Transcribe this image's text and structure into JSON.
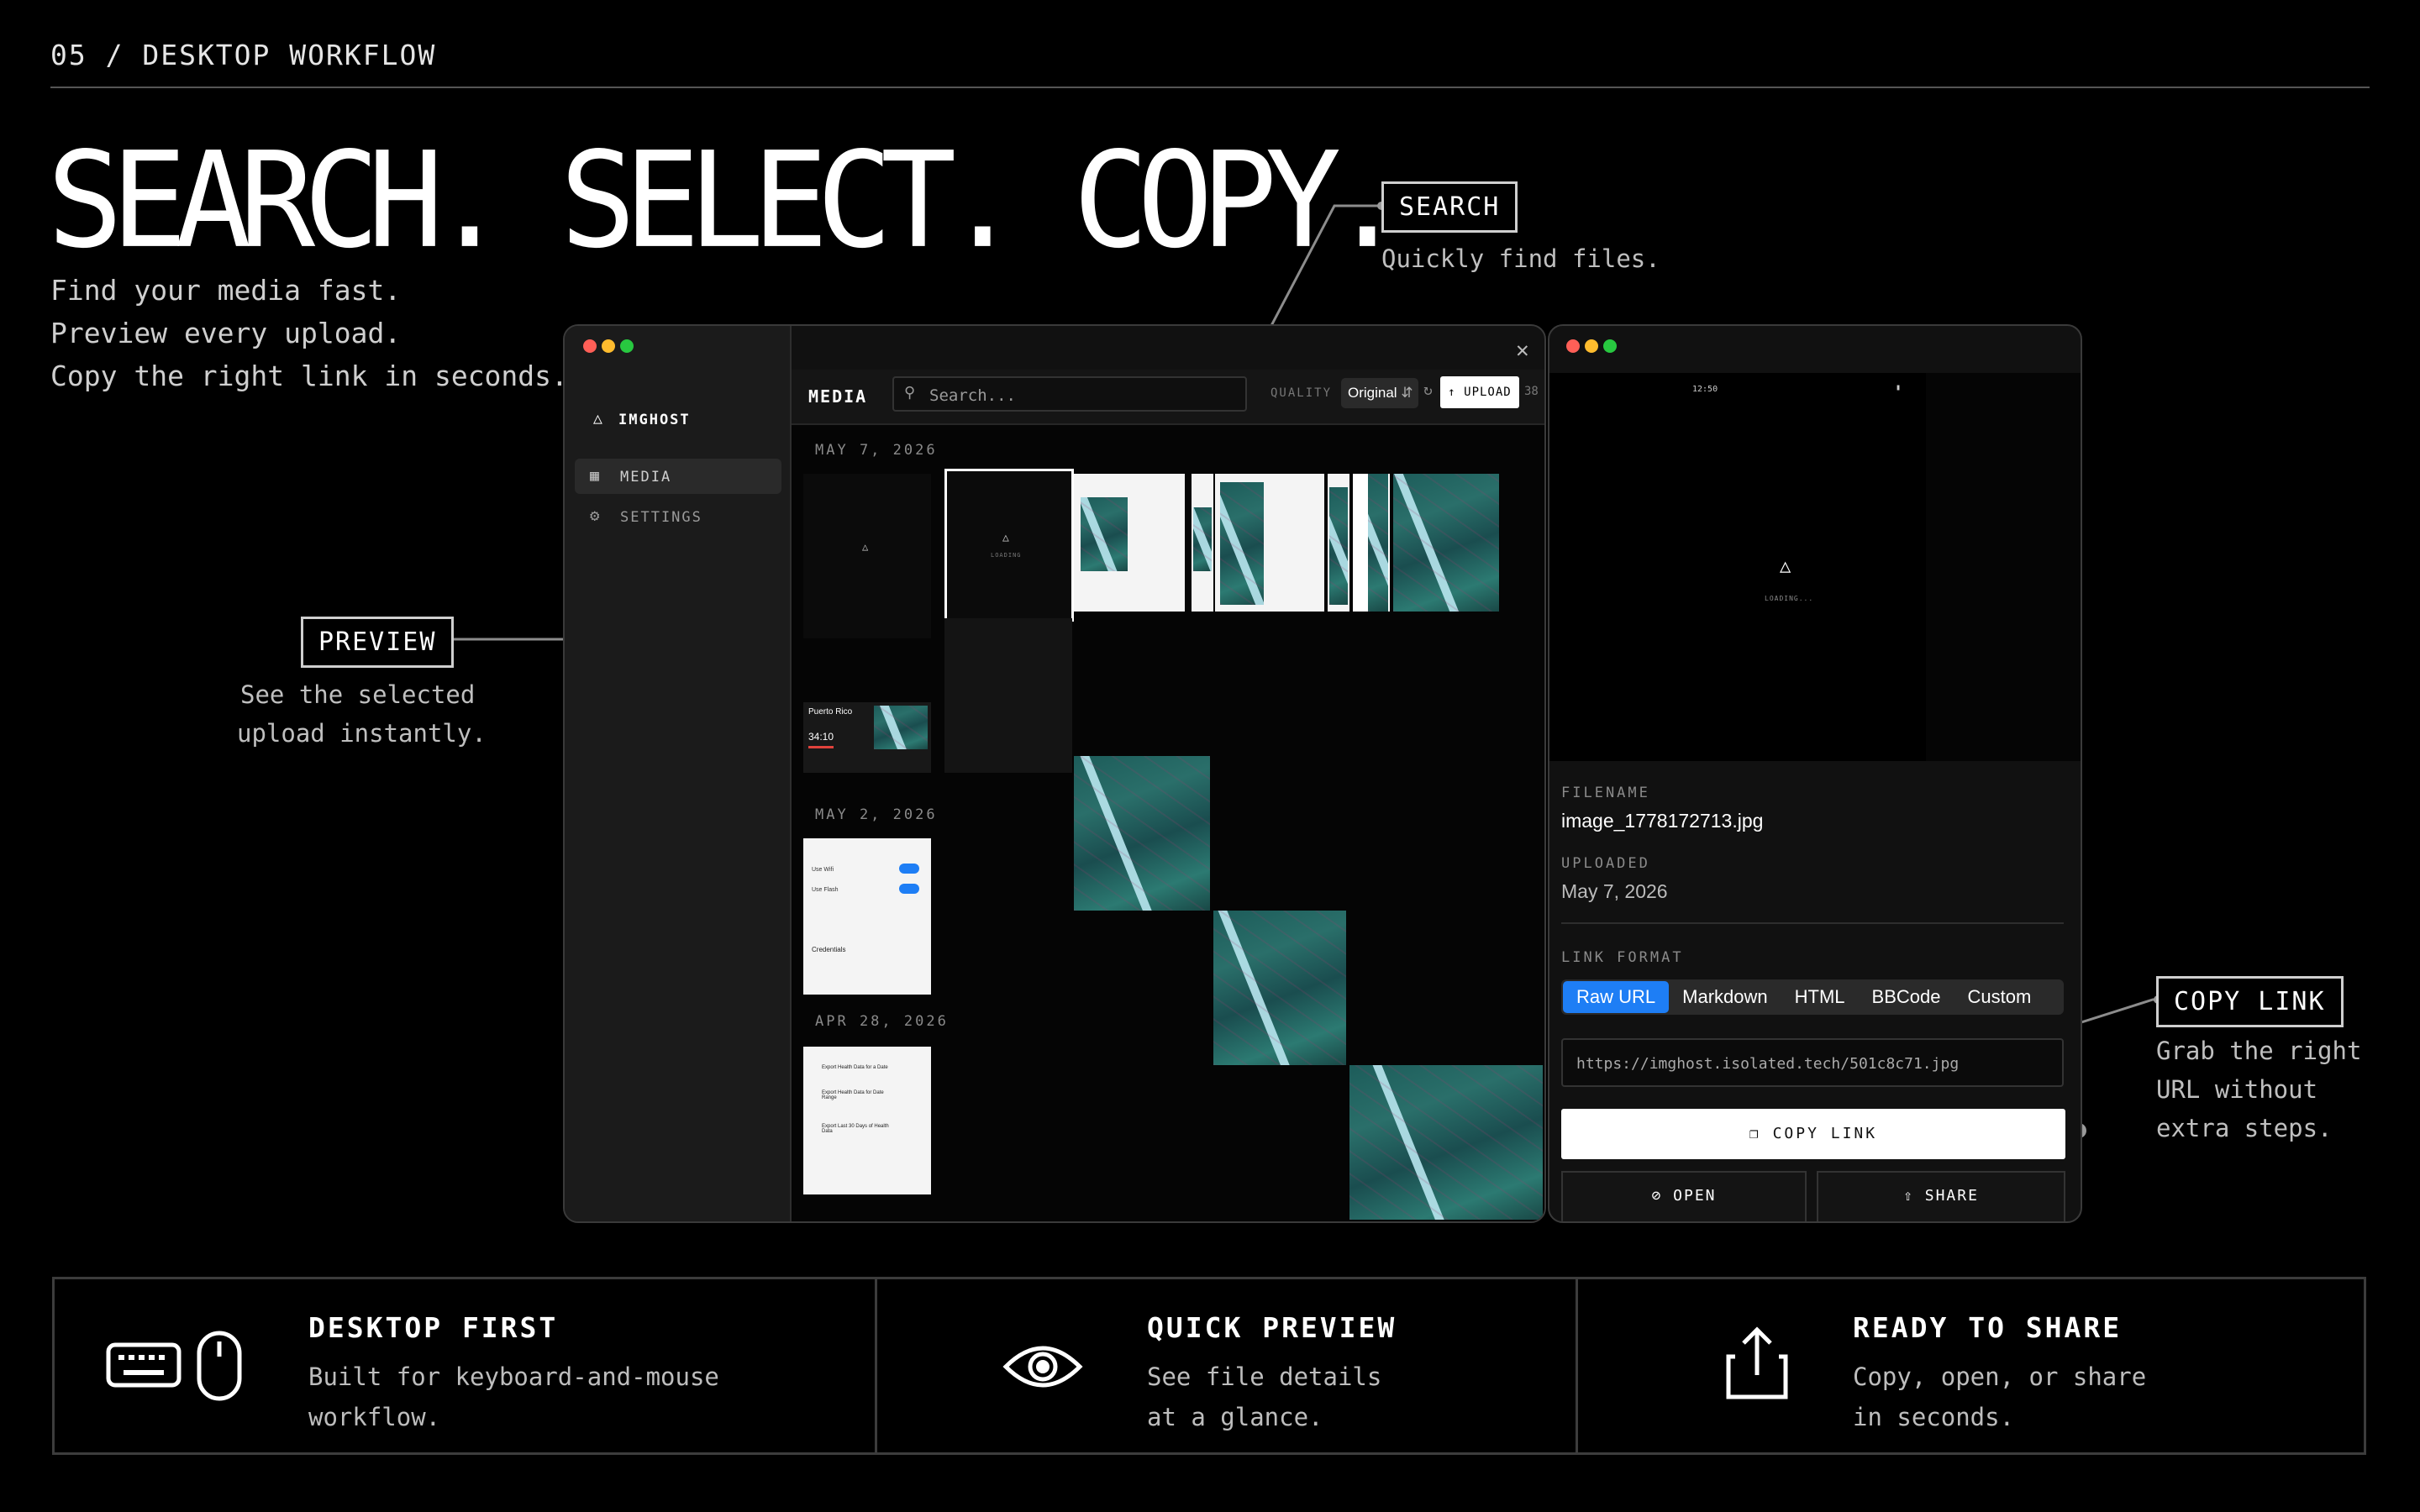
{
  "page": {
    "section_label": "05 / DESKTOP WORKFLOW",
    "headline": "SEARCH. SELECT. COPY.",
    "subtitle_lines": [
      "Find your media fast.",
      "Preview every upload.",
      "Copy the right link in seconds."
    ]
  },
  "callouts": {
    "search": {
      "title": "SEARCH",
      "text": "Quickly find files."
    },
    "preview": {
      "title": "PREVIEW",
      "line1": "See the selected",
      "line2": "upload instantly."
    },
    "copy_link": {
      "title": "COPY LINK",
      "line1": "Grab the right",
      "line2": "URL without",
      "line3": "extra steps."
    }
  },
  "app": {
    "brand": "IMGHOST",
    "sidebar": {
      "items": [
        {
          "label": "MEDIA",
          "icon": "grid-icon"
        },
        {
          "label": "SETTINGS",
          "icon": "gear-icon"
        }
      ]
    },
    "toolbar": {
      "title": "MEDIA",
      "search_placeholder": "Search...",
      "quality_label": "QUALITY",
      "quality_value": "Original",
      "upload_label": "UPLOAD",
      "count": "38"
    },
    "groups": [
      {
        "date": "MAY 7, 2026"
      },
      {
        "date": "MAY 2, 2026"
      },
      {
        "date": "APR 28, 2026"
      }
    ],
    "tiles": {
      "loading": "LOADING",
      "puerto_rico": {
        "title": "Puerto Rico",
        "value": "34:10"
      },
      "settings_rows": [
        "Use Wifi",
        "Use Flash",
        "Credentials"
      ],
      "health_rows": [
        "Export Health Data for a Date",
        "Export Health Data for Date Range",
        "Export Last 30 Days of Health Data"
      ]
    }
  },
  "detail": {
    "status_time": "12:50",
    "loading": "LOADING...",
    "filename_label": "FILENAME",
    "filename": "image_1778172713.jpg",
    "uploaded_label": "UPLOADED",
    "uploaded": "May 7, 2026",
    "link_format_label": "LINK FORMAT",
    "formats": [
      "Raw URL",
      "Markdown",
      "HTML",
      "BBCode",
      "Custom"
    ],
    "url": "https://imghost.isolated.tech/501c8c71.jpg",
    "copy_label": "COPY LINK",
    "open_label": "OPEN",
    "share_label": "SHARE"
  },
  "features": [
    {
      "title": "DESKTOP FIRST",
      "line1": "Built for keyboard-and-mouse",
      "line2": "workflow.",
      "icon": "keyboard-mouse-icon"
    },
    {
      "title": "QUICK PREVIEW",
      "line1": "See file details",
      "line2": "at a glance.",
      "icon": "eye-icon"
    },
    {
      "title": "READY TO SHARE",
      "line1": "Copy, open, or share",
      "line2": "in seconds.",
      "icon": "share-icon"
    }
  ],
  "colors": {
    "accent": "#1e7ef5",
    "close_red": "#ff5f57",
    "min_yellow": "#febc2e",
    "max_green": "#28c840"
  }
}
